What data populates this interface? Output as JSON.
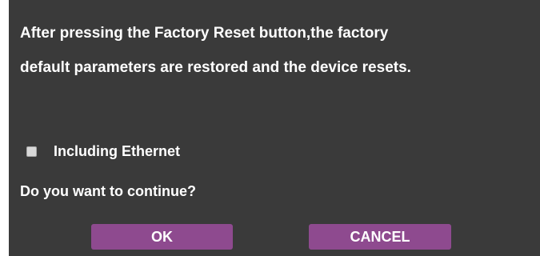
{
  "dialog": {
    "message_line1": "After pressing the Factory Reset button,the factory",
    "message_line2": "default parameters are restored and the device resets.",
    "checkbox_label": "Including Ethernet",
    "checkbox_checked": false,
    "question": "Do you want to continue?",
    "ok_label": "OK",
    "cancel_label": "CANCEL"
  },
  "colors": {
    "dialog_background": "#3a3a3a",
    "button_background": "#8e4a8f",
    "text": "#ffffff"
  }
}
